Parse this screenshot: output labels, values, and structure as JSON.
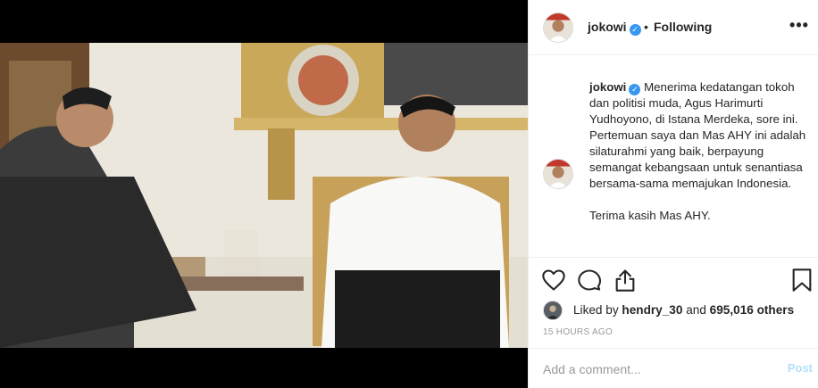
{
  "header": {
    "username": "jokowi",
    "separator": "•",
    "follow_status": "Following",
    "more_icon": "more-horizontal-icon"
  },
  "caption": {
    "username": "jokowi",
    "text": "Menerima kedatangan tokoh dan politisi muda, Agus Harimurti Yudhoyono, di Istana Merdeka, sore ini. Pertemuan saya dan Mas AHY ini adalah silaturahmi yang baik, berpayung semangat kebangsaan untuk senantiasa bersama-sama memajukan Indonesia.",
    "closing": "Terima kasih Mas AHY."
  },
  "actions": {
    "like_icon": "heart-icon",
    "comment_icon": "comment-bubble-icon",
    "share_icon": "share-icon",
    "save_icon": "bookmark-icon"
  },
  "likes": {
    "prefix": "Liked by ",
    "user": "hendry_30",
    "middle": " and ",
    "count": "695,016 others"
  },
  "timestamp": "15 HOURS AGO",
  "comment": {
    "placeholder": "Add a comment...",
    "post_label": "Post"
  },
  "colors": {
    "verified": "#3897f0",
    "text": "#262626",
    "muted": "#999999",
    "post_disabled": "#b2dffc",
    "border": "#efefef"
  }
}
